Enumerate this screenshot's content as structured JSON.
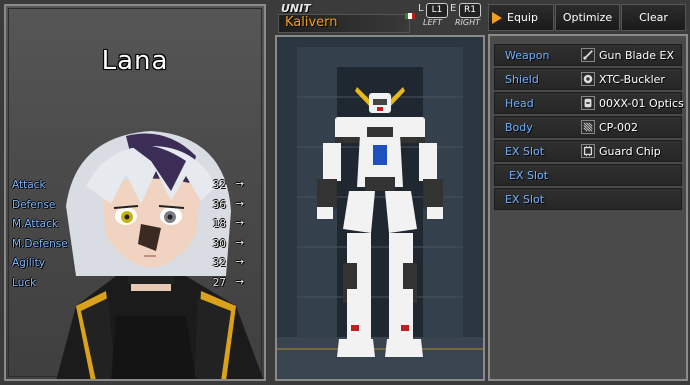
{
  "character": {
    "name": "Lana",
    "stats": [
      {
        "label": "Attack",
        "value": "32",
        "arrow": "→"
      },
      {
        "label": "Defense",
        "value": "36",
        "arrow": "→"
      },
      {
        "label": "M.Attack",
        "value": "18",
        "arrow": "→"
      },
      {
        "label": "M.Defense",
        "value": "30",
        "arrow": "→"
      },
      {
        "label": "Agility",
        "value": "32",
        "arrow": "→"
      },
      {
        "label": "Luck",
        "value": "27",
        "arrow": "→"
      }
    ]
  },
  "unit": {
    "label": "UNIT",
    "name": "Kalivern",
    "switch_hint": {
      "left_key": "L1",
      "left_text": "LEFT",
      "right_key": "R1",
      "right_text": "RIGHT",
      "separator_l": "L",
      "separator_e": "E"
    }
  },
  "buttons": {
    "equip": "Equip",
    "optimize": "Optimize",
    "clear": "Clear"
  },
  "slots": [
    {
      "label": "Weapon",
      "item": "Gun Blade EX",
      "icon": "sword-icon"
    },
    {
      "label": "Shield",
      "item": "XTC-Buckler",
      "icon": "shield-icon"
    },
    {
      "label": "Head",
      "item": "00XX-01 Optics",
      "icon": "helmet-icon"
    },
    {
      "label": "Body",
      "item": "CP-002",
      "icon": "armor-icon"
    },
    {
      "label": "EX Slot",
      "item": "Guard Chip",
      "icon": "chip-icon"
    },
    {
      "label": "EX Slot",
      "item": "",
      "icon": ""
    },
    {
      "label": "EX Slot",
      "item": "",
      "icon": ""
    }
  ],
  "colors": {
    "accent_orange": "#f0a020",
    "label_blue": "#6fb0ff",
    "panel_gray": "#4a4a4a"
  }
}
